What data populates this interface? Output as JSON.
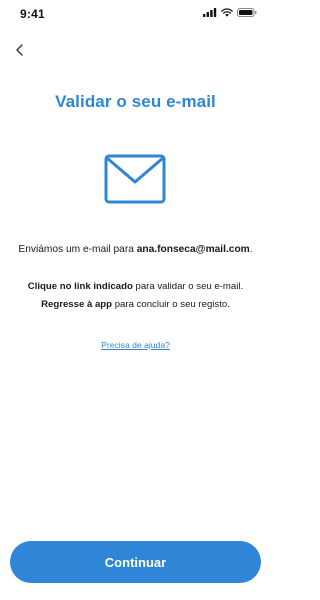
{
  "status_bar": {
    "time": "9:41",
    "icons": [
      "signal-icon",
      "wifi-icon",
      "battery-icon"
    ]
  },
  "nav": {
    "back_icon": "chevron-left-icon"
  },
  "content": {
    "title": "Validar o seu e-mail",
    "illustration_icon": "envelope-icon",
    "sent_prefix": "Enviámos um e-mail para ",
    "email": "ana.fonseca@mail.com",
    "sent_suffix": ".",
    "step1_bold": "Clique no link indicado",
    "step1_rest": " para validar o seu e-mail.",
    "step2_bold": "Regresse à app",
    "step2_rest": " para concluir o seu registo.",
    "help_link": "Precisa de ajuda?"
  },
  "footer": {
    "continue_label": "Continuar"
  },
  "colors": {
    "accent": "#2f86d6",
    "text": "#1a1a1a",
    "background": "#ffffff"
  }
}
